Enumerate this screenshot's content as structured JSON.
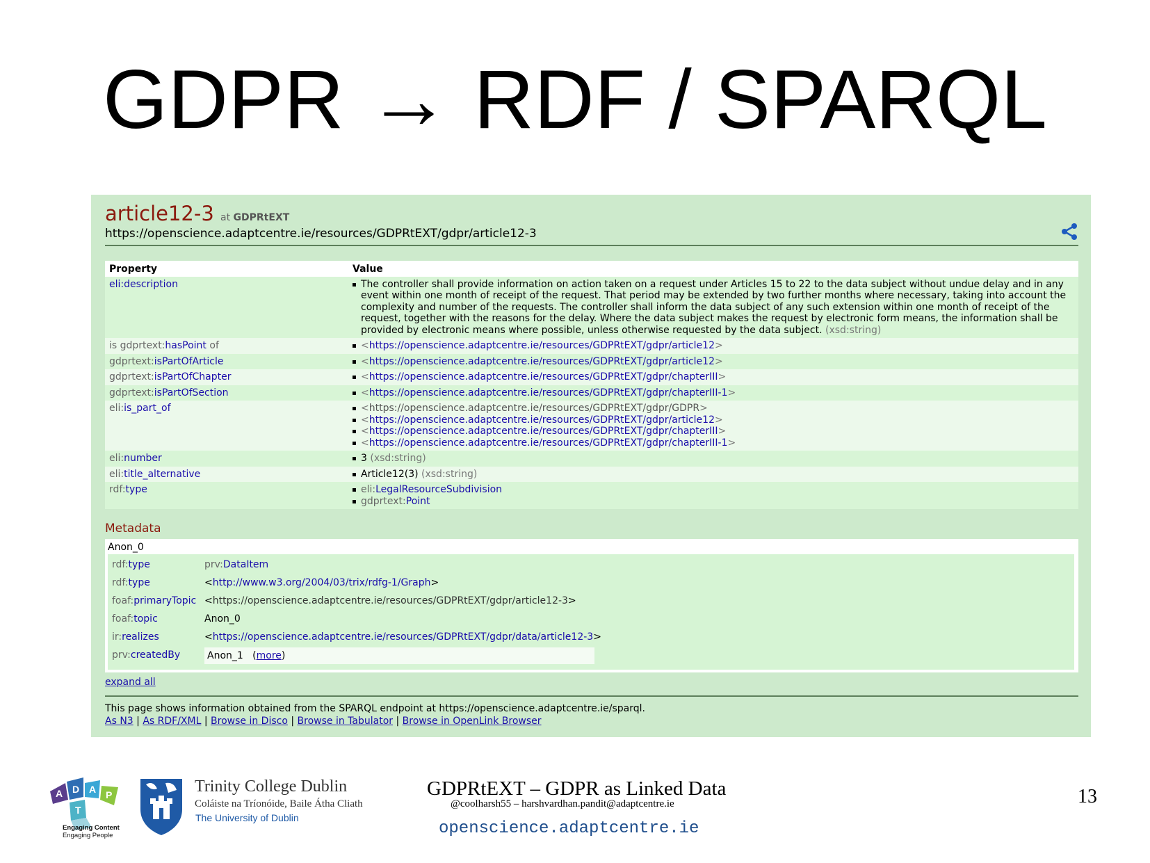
{
  "slide": {
    "title": "GDPR → RDF / SPARQL",
    "footer_title": "GDPRtEXT – GDPR as Linked Data",
    "footer_sub": "@coolharsh55 –  harshvardhan.pandit@adaptcentre.ie",
    "footer_url": "opensciencе.adaptcentre.ie",
    "page_number": "13"
  },
  "logos": {
    "adapt_letters": [
      "A",
      "D",
      "A",
      "P",
      "T"
    ],
    "adapt_tag_bold": "Engaging Content",
    "adapt_tag": "Engaging People",
    "tcd_name": "Trinity College Dublin",
    "tcd_irish": "Coláiste na Tríonóide, Baile Átha Cliath",
    "tcd_uni": "The University of Dublin"
  },
  "resource": {
    "name": "article12-3",
    "at_label": "at",
    "dataset": "GDPRtEXT",
    "uri": "https://openscience.adaptcentre.ie/resources/GDPRtEXT/gdpr/article12-3"
  },
  "table": {
    "header_property": "Property",
    "header_value": "Value",
    "rows": {
      "description": {
        "prefix": "eli:",
        "local": "description",
        "value": "The controller shall provide information on action taken on a request under Articles 15 to 22 to the data subject without undue delay and in any event within one month of receipt of the request. That period may be extended by two further months where necessary, taking into account the complexity and number of the requests. The controller shall inform the data subject of any such extension within one month of receipt of the request, together with the reasons for the delay. Where the data subject makes the request by electronic form means, the information shall be provided by electronic means where possible, unless otherwise requested by the data subject.",
        "datatype": "(xsd:string)"
      },
      "haspoint": {
        "pre": "is gdprtext:",
        "local": "hasPoint",
        "post": " of",
        "value": "https://openscience.adaptcentre.ie/resources/GDPRtEXT/gdpr/article12"
      },
      "ispartofarticle": {
        "prefix": "gdprtext:",
        "local": "isPartOfArticle",
        "value": "https://openscience.adaptcentre.ie/resources/GDPRtEXT/gdpr/article12"
      },
      "ispartofchapter": {
        "prefix": "gdprtext:",
        "local": "isPartOfChapter",
        "value": "https://openscience.adaptcentre.ie/resources/GDPRtEXT/gdpr/chapterIII"
      },
      "ispartofsection": {
        "prefix": "gdprtext:",
        "local": "isPartOfSection",
        "value": "https://openscience.adaptcentre.ie/resources/GDPRtEXT/gdpr/chapterIII-1"
      },
      "is_part_of": {
        "prefix": "eli:",
        "local": "is_part_of",
        "values": [
          "https://openscience.adaptcentre.ie/resources/GDPRtEXT/gdpr/GDPR",
          "https://openscience.adaptcentre.ie/resources/GDPRtEXT/gdpr/article12",
          "https://openscience.adaptcentre.ie/resources/GDPRtEXT/gdpr/chapterIII",
          "https://openscience.adaptcentre.ie/resources/GDPRtEXT/gdpr/chapterIII-1"
        ]
      },
      "number": {
        "prefix": "eli:",
        "local": "number",
        "value": "3",
        "datatype": "(xsd:string)"
      },
      "title_alternative": {
        "prefix": "eli:",
        "local": "title_alternative",
        "value": "Article12(3)",
        "datatype": "(xsd:string)"
      },
      "type": {
        "prefix": "rdf:",
        "local": "type",
        "values": [
          {
            "prefix": "eli:",
            "local": "LegalResourceSubdivision"
          },
          {
            "prefix": "gdprtext:",
            "local": "Point"
          }
        ]
      }
    }
  },
  "metadata": {
    "heading": "Metadata",
    "node": "Anon_0",
    "rows": {
      "type1": {
        "prefix": "rdf:",
        "local": "type",
        "vprefix": "prv:",
        "vlocal": "DataItem"
      },
      "type2": {
        "prefix": "rdf:",
        "local": "type",
        "value": "http://www.w3.org/2004/03/trix/rdfg-1/Graph"
      },
      "primarytopic": {
        "prefix": "foaf:",
        "local": "primaryTopic",
        "value": "https://openscience.adaptcentre.ie/resources/GDPRtEXT/gdpr/article12-3"
      },
      "topic": {
        "prefix": "foaf:",
        "local": "topic",
        "value": "Anon_0"
      },
      "realizes": {
        "prefix": "ir:",
        "local": "realizes",
        "value": "https://openscience.adaptcentre.ie/resources/GDPRtEXT/gdpr/data/article12-3"
      },
      "createdby": {
        "prefix": "prv:",
        "local": "createdBy",
        "value": "Anon_1",
        "more": "more"
      }
    },
    "expand_all": "expand all"
  },
  "footer": {
    "text": "This page shows information obtained from the SPARQL endpoint at https://openscience.adaptcentre.ie/sparql.",
    "links": [
      "As N3",
      "As RDF/XML",
      "Browse in Disco",
      "Browse in Tabulator",
      "Browse in OpenLink Browser"
    ],
    "separator": " | "
  },
  "colors": {
    "page_bg": "#cdeacc",
    "title_red": "#8b1a0e",
    "link_blue": "#1a0dab",
    "row_odd": "#d8f5d6",
    "row_even": "#ecf9eb"
  }
}
